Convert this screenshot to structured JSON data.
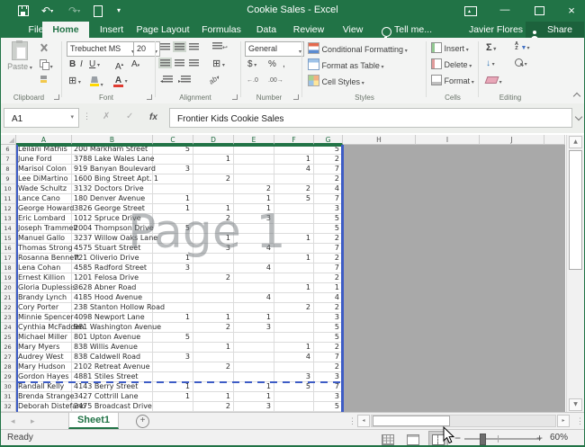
{
  "window": {
    "title": "Cookie Sales - Excel"
  },
  "tabs": {
    "items": [
      "File",
      "Home",
      "Insert",
      "Page Layout",
      "Formulas",
      "Data",
      "Review",
      "View"
    ],
    "active": "Home",
    "tell_me": "Tell me...",
    "user": "Javier Flores",
    "share": "Share"
  },
  "ribbon": {
    "clipboard": {
      "label": "Clipboard",
      "paste": "Paste"
    },
    "font": {
      "label": "Font",
      "name": "Trebuchet MS",
      "size": "20",
      "bold": "B",
      "italic": "I",
      "underline": "U"
    },
    "alignment": {
      "label": "Alignment"
    },
    "number": {
      "label": "Number",
      "format": "General",
      "currency": "$",
      "percent": "%",
      "comma": ",",
      "increase_decimal": "←.0",
      "decrease_decimal": ".00→"
    },
    "styles": {
      "label": "Styles",
      "buttons": [
        "Conditional Formatting",
        "Format as Table",
        "Cell Styles"
      ]
    },
    "cells": {
      "label": "Cells",
      "buttons": [
        "Insert",
        "Delete",
        "Format"
      ]
    },
    "editing": {
      "label": "Editing",
      "autosum": "Σ",
      "sort_a": "A",
      "sort_z": "Z"
    }
  },
  "formula_bar": {
    "name_box": "A1",
    "fx": "fx",
    "formula": "Frontier Kids Cookie Sales"
  },
  "sheet": {
    "columns": [
      "A",
      "B",
      "C",
      "D",
      "E",
      "F",
      "G",
      "H",
      "I",
      "J"
    ],
    "watermark": "Page 1",
    "rows": [
      {
        "row": 6,
        "name": "Leilani Mathis",
        "address": "200 Markham Street",
        "values": [
          "5",
          "",
          "",
          "",
          "5"
        ]
      },
      {
        "row": 7,
        "name": "June Ford",
        "address": "3788 Lake Wales Lane",
        "values": [
          "",
          "1",
          "",
          "1",
          "2"
        ]
      },
      {
        "row": 8,
        "name": "Marisol Colon",
        "address": "919 Banyan Boulevard",
        "values": [
          "3",
          "",
          "",
          "4",
          "7"
        ]
      },
      {
        "row": 9,
        "name": "Lee DiMartino",
        "address": "1600 Bing Street Apt. 1",
        "values": [
          "",
          "2",
          "",
          "",
          "2"
        ]
      },
      {
        "row": 10,
        "name": "Wade Schultz",
        "address": "3132 Doctors Drive",
        "values": [
          "",
          "",
          "2",
          "2",
          "4"
        ]
      },
      {
        "row": 11,
        "name": "Lance Cano",
        "address": "180 Denver Avenue",
        "values": [
          "1",
          "",
          "1",
          "5",
          "7"
        ]
      },
      {
        "row": 12,
        "name": "George Howard",
        "address": "3826 George Street",
        "values": [
          "1",
          "1",
          "1",
          "",
          "3"
        ]
      },
      {
        "row": 13,
        "name": "Eric Lombard",
        "address": "1012 Spruce Drive",
        "values": [
          "",
          "2",
          "3",
          "",
          "5"
        ]
      },
      {
        "row": 14,
        "name": "Joseph Trammell",
        "address": "2004 Thompson Drive",
        "values": [
          "5",
          "",
          "",
          "",
          "5"
        ]
      },
      {
        "row": 15,
        "name": "Manuel Gallo",
        "address": "3237 Willow Oaks Lane",
        "values": [
          "",
          "1",
          "",
          "1",
          "2"
        ]
      },
      {
        "row": 16,
        "name": "Thomas Strong",
        "address": "4575 Stuart Street",
        "values": [
          "",
          "3",
          "4",
          "",
          "7"
        ]
      },
      {
        "row": 17,
        "name": "Rosanna Bennett",
        "address": "721 Oliverio Drive",
        "values": [
          "1",
          "",
          "",
          "1",
          "2"
        ]
      },
      {
        "row": 18,
        "name": "Lena Cohan",
        "address": "4585 Radford Street",
        "values": [
          "3",
          "",
          "4",
          "",
          "7"
        ]
      },
      {
        "row": 19,
        "name": "Ernest Killion",
        "address": "1201 Felosa Drive",
        "values": [
          "",
          "2",
          "",
          "",
          "2"
        ]
      },
      {
        "row": 20,
        "name": "Gloria Duplessis",
        "address": "3628 Abner Road",
        "values": [
          "",
          "",
          "",
          "1",
          "1"
        ]
      },
      {
        "row": 21,
        "name": "Brandy Lynch",
        "address": "4185 Hood Avenue",
        "values": [
          "",
          "",
          "4",
          "",
          "4"
        ]
      },
      {
        "row": 22,
        "name": "Cory Porter",
        "address": "238 Stanton Hollow Road",
        "values": [
          "",
          "",
          "",
          "2",
          "2"
        ]
      },
      {
        "row": 23,
        "name": "Minnie Spencer",
        "address": "4098 Newport Lane",
        "values": [
          "1",
          "1",
          "1",
          "",
          "3"
        ]
      },
      {
        "row": 24,
        "name": "Cynthia McFadden",
        "address": "981 Washington Avenue",
        "values": [
          "",
          "2",
          "3",
          "",
          "5"
        ]
      },
      {
        "row": 25,
        "name": "Michael Miller",
        "address": "801 Upton Avenue",
        "values": [
          "5",
          "",
          "",
          "",
          "5"
        ]
      },
      {
        "row": 26,
        "name": "Mary Myers",
        "address": "838 Willis Avenue",
        "values": [
          "",
          "1",
          "",
          "1",
          "2"
        ]
      },
      {
        "row": 27,
        "name": "Audrey West",
        "address": "838 Caldwell Road",
        "values": [
          "3",
          "",
          "",
          "4",
          "7"
        ]
      },
      {
        "row": 28,
        "name": "Mary Hudson",
        "address": "2102 Retreat Avenue",
        "values": [
          "",
          "2",
          "",
          "",
          "2"
        ]
      },
      {
        "row": 29,
        "name": "Gordon Hayes",
        "address": "4881 Stiles Street",
        "values": [
          "",
          "",
          "",
          "3",
          "3"
        ]
      },
      {
        "row": 30,
        "name": "Randall Kelly",
        "address": "4143 Berry Street",
        "values": [
          "1",
          "",
          "1",
          "5",
          "7"
        ]
      },
      {
        "row": 31,
        "name": "Brenda Strange",
        "address": "3427 Cottrill Lane",
        "values": [
          "1",
          "1",
          "1",
          "",
          "3"
        ]
      },
      {
        "row": 32,
        "name": "Deborah Distefano",
        "address": "2475 Broadcast Drive",
        "values": [
          "",
          "2",
          "3",
          "",
          "5"
        ]
      }
    ]
  },
  "sheet_tabs": {
    "active": "Sheet1"
  },
  "status_bar": {
    "mode": "Ready",
    "zoom_level": "60%"
  }
}
